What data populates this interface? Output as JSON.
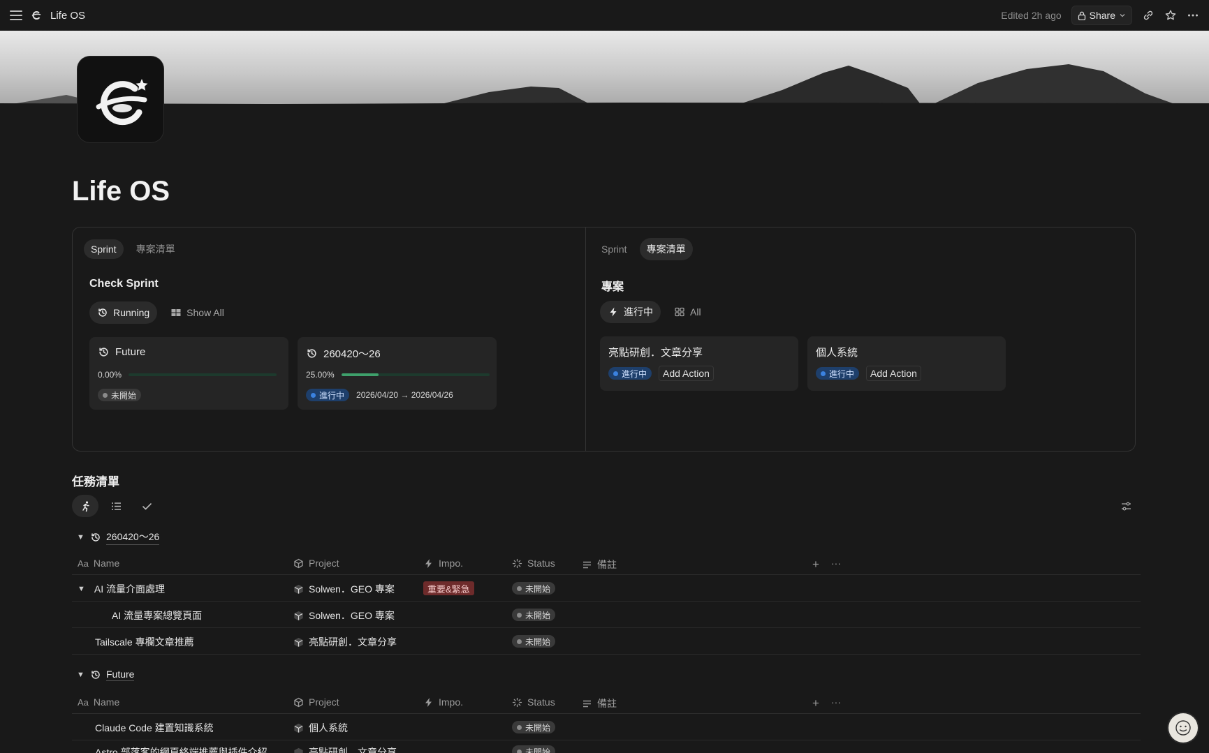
{
  "topbar": {
    "title": "Life OS",
    "edited": "Edited 2h ago",
    "share_label": "Share"
  },
  "page": {
    "title": "Life OS"
  },
  "left_panel": {
    "tabs": [
      "Sprint",
      "專案清單"
    ],
    "active_tab": "Sprint",
    "section_title": "Check Sprint",
    "filters": [
      {
        "label": "Running",
        "icon": "history-icon",
        "active": true
      },
      {
        "label": "Show All",
        "icon": "grid-icon",
        "active": false
      }
    ],
    "cards": [
      {
        "title": "Future",
        "progress_text": "0.00%",
        "progress": 0.0,
        "status": "未開始",
        "status_color": "gray",
        "dates": ""
      },
      {
        "title": "260420～26",
        "progress_text": "25.00%",
        "progress": 0.25,
        "status": "進行中",
        "status_color": "blue",
        "dates": "2026/04/20 → 2026/04/26"
      }
    ]
  },
  "right_panel": {
    "tabs": [
      "Sprint",
      "專案清單"
    ],
    "active_tab": "專案清單",
    "section_title": "專案",
    "filters": [
      {
        "label": "進行中",
        "icon": "bolt-icon",
        "active": true
      },
      {
        "label": "All",
        "icon": "gallery-icon",
        "active": false
      }
    ],
    "cards": [
      {
        "title": "亮點研創．文章分享",
        "status": "進行中",
        "action": "Add Action"
      },
      {
        "title": "個人系統",
        "status": "進行中",
        "action": "Add Action"
      }
    ]
  },
  "tasks": {
    "title": "任務清單",
    "columns": {
      "name": "Name",
      "project": "Project",
      "impo": "Impo.",
      "status": "Status",
      "note": "備註"
    },
    "groups": [
      {
        "label": "260420～26",
        "rows": [
          {
            "name": "AI 流量介面處理",
            "project": "Solwen．GEO 專案",
            "impo": "重要&緊急",
            "status": "未開始",
            "expandable": true,
            "indent": false
          },
          {
            "name": "AI 流量專案總覽頁面",
            "project": "Solwen．GEO 專案",
            "impo": "",
            "status": "未開始",
            "expandable": false,
            "indent": true
          },
          {
            "name": "Tailscale 專欄文章推薦",
            "project": "亮點研創．文章分享",
            "impo": "",
            "status": "未開始",
            "expandable": false,
            "indent": false
          }
        ]
      },
      {
        "label": "Future",
        "rows": [
          {
            "name": "Claude Code 建置知識系統",
            "project": "個人系統",
            "impo": "",
            "status": "未開始",
            "expandable": false,
            "indent": false
          },
          {
            "name": "Astro 部落客的網頁終端推薦與插件介紹",
            "project": "亮點研創．文章分享",
            "impo": "",
            "status": "未開始",
            "expandable": false,
            "indent": false
          }
        ]
      }
    ]
  },
  "colors": {
    "background": "#191919",
    "progress_green": "#3ea06b",
    "status_blue": "#1e3f6b",
    "impo_red": "#6e2b2b"
  }
}
